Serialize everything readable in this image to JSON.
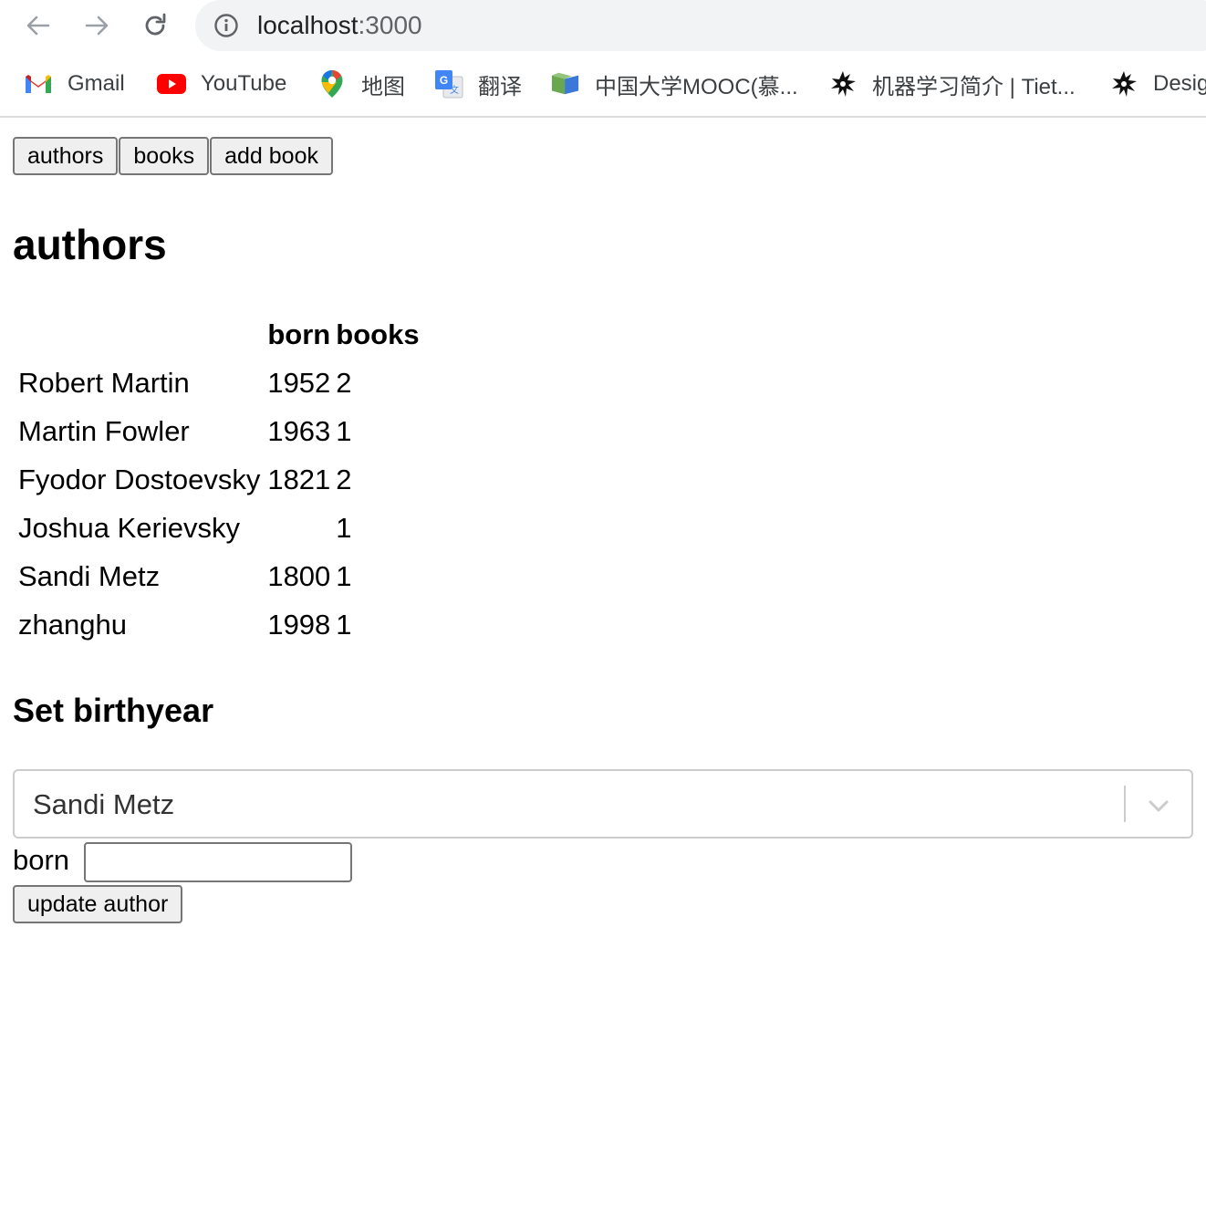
{
  "browser": {
    "url_host": "localhost",
    "url_port": ":3000",
    "bookmarks": [
      {
        "label": "Gmail",
        "icon": "gmail-icon"
      },
      {
        "label": "YouTube",
        "icon": "youtube-icon"
      },
      {
        "label": "地图",
        "icon": "maps-pin-icon"
      },
      {
        "label": "翻译",
        "icon": "translate-icon"
      },
      {
        "label": "中国大学MOOC(慕...",
        "icon": "mooc-icon"
      },
      {
        "label": "机器学习简介 | Tiet...",
        "icon": "bird-icon"
      },
      {
        "label": "Desig",
        "icon": "bird-icon"
      }
    ]
  },
  "nav_buttons": {
    "authors": "authors",
    "books": "books",
    "add_book": "add book"
  },
  "page": {
    "title": "authors",
    "table": {
      "columns": [
        "",
        "born",
        "books"
      ],
      "rows": [
        {
          "name": "Robert Martin",
          "born": "1952",
          "books": "2"
        },
        {
          "name": "Martin Fowler",
          "born": "1963",
          "books": "1"
        },
        {
          "name": "Fyodor Dostoevsky",
          "born": "1821",
          "books": "2"
        },
        {
          "name": "Joshua Kerievsky",
          "born": "",
          "books": "1"
        },
        {
          "name": "Sandi Metz",
          "born": "1800",
          "books": "1"
        },
        {
          "name": "zhanghu",
          "born": "1998",
          "books": "1"
        }
      ]
    },
    "birthyear_form": {
      "title": "Set birthyear",
      "selected_author": "Sandi Metz",
      "born_label": "born",
      "born_value": "",
      "submit_label": "update author"
    }
  },
  "colors": {
    "omnibox_bg": "#f1f3f4",
    "button_bg": "#efefef",
    "select_border": "#cccccc"
  }
}
